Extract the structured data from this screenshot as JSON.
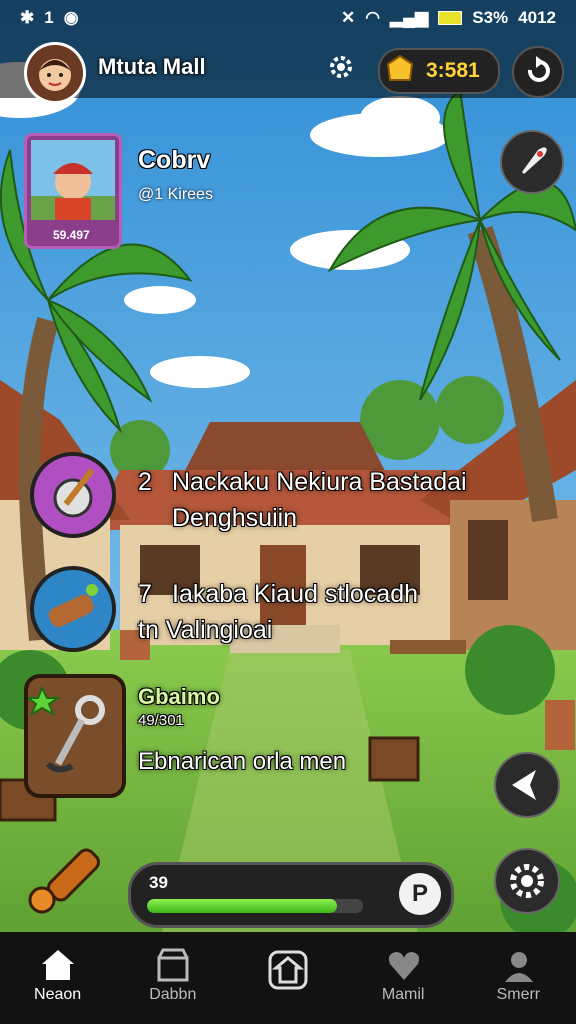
{
  "status_bar": {
    "left_icons": [
      "bluetooth-icon",
      "1",
      "circle-icon"
    ],
    "right_text_battery": "S3%",
    "time": "4012"
  },
  "header": {
    "title": "Mtuta Mall",
    "coins": "3:581"
  },
  "profile": {
    "name": "Cobrv",
    "subtitle": "@1 Kirees",
    "badge": "59.497"
  },
  "quests": [
    {
      "number": "2",
      "line1": "Nackaku Nekiura Bastadai",
      "line2": "Denghsuiin"
    },
    {
      "number": "7",
      "line1": "Iakaba Kiaud stlocadh",
      "line2": "tn Valingioai"
    }
  ],
  "tool": {
    "title": "Gbaimo",
    "sub": "49/301",
    "caption": "Ebnarican orla men"
  },
  "progress": {
    "label": "39",
    "level": 0.88,
    "button": "P"
  },
  "bottom_nav": [
    {
      "label": "Neaon",
      "icon": "home-icon",
      "active": true
    },
    {
      "label": "Dabbn",
      "icon": "store-icon",
      "active": false
    },
    {
      "label": "",
      "icon": "map-icon",
      "active": false
    },
    {
      "label": "Mamil",
      "icon": "heart-icon",
      "active": false
    },
    {
      "label": "Smerr",
      "icon": "profile-icon",
      "active": false
    }
  ],
  "colors": {
    "sky": "#5fb4e8",
    "grass": "#7fbf45",
    "roof": "#9c4a2a",
    "accent_gold": "#ffd23a",
    "progress_green": "#4cc624"
  }
}
